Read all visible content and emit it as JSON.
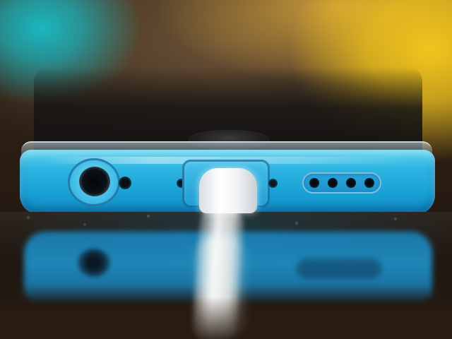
{
  "image": {
    "subject": "iphone-bottom-edge-charging",
    "palette": {
      "phone_blue": "#1fa6dc",
      "background_teal": "#19b7c0",
      "background_yellow": "#f2c51c",
      "table_brown": "#2a1c12",
      "cable_white": "#f4f4f2"
    },
    "speaker_holes": 4,
    "screws": 2
  }
}
